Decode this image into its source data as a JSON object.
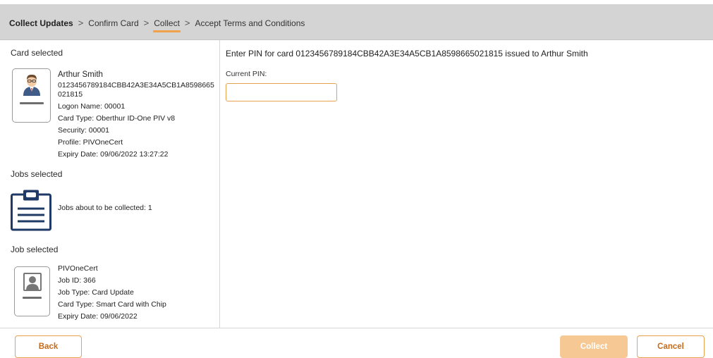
{
  "breadcrumb": {
    "items": [
      "Collect Updates",
      "Confirm Card",
      "Collect",
      "Accept Terms and Conditions"
    ],
    "separator": ">",
    "current_index": 2
  },
  "left": {
    "card_section_title": "Card selected",
    "card": {
      "name": "Arthur Smith",
      "number": "0123456789184CBB42A3E34A5CB1A8598665021815",
      "logon": "Logon Name: 00001",
      "type": "Card Type: Oberthur ID-One PIV v8",
      "security": "Security: 00001",
      "profile": "Profile: PIVOneCert",
      "expiry": "Expiry Date: 09/06/2022 13:27:22"
    },
    "jobs_section_title": "Jobs selected",
    "jobs_text": "Jobs about to be collected: 1",
    "job_section_title": "Job selected",
    "job": {
      "profile": "PIVOneCert",
      "id": "Job ID: 366",
      "type": "Job Type: Card Update",
      "card_type": "Card Type: Smart Card with Chip",
      "expiry": "Expiry Date: 09/06/2022"
    }
  },
  "right": {
    "heading": "Enter PIN for card 0123456789184CBB42A3E34A5CB1A8598665021815 issued to Arthur Smith",
    "pin_label": "Current PIN:",
    "pin_value": ""
  },
  "footer": {
    "back_label": "Back",
    "collect_label": "Collect",
    "cancel_label": "Cancel"
  },
  "colors": {
    "accent": "#e8a14f",
    "accent_disabled": "#f6c894",
    "header_bg": "#d4d4d4",
    "icon_navy": "#1f3a66"
  }
}
